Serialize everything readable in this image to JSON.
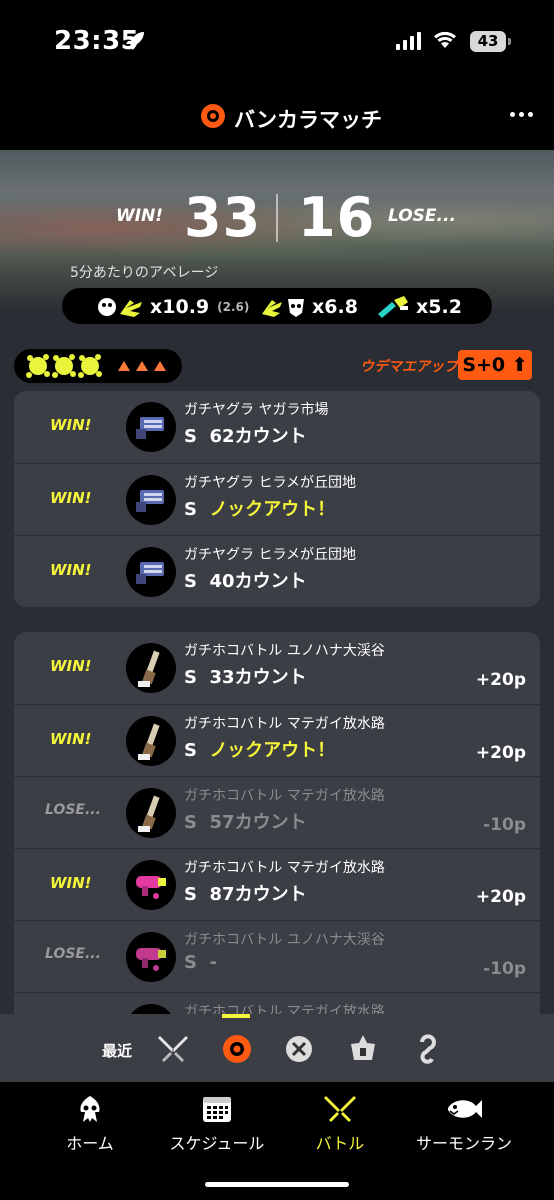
{
  "status_bar": {
    "time": "23:35",
    "battery": "43"
  },
  "header": {
    "title": "バンカラマッチ"
  },
  "summary": {
    "win_label": "WIN!",
    "lose_label": "LOSE...",
    "wins": "33",
    "losses": "16",
    "average_label": "5分あたりのアベレージ",
    "kills": "x10.9",
    "assists": "(2.6)",
    "deaths": "x6.8",
    "specials": "x5.2"
  },
  "rank": {
    "rank_up_text": "ウデマエアップ!",
    "rank_badge": "S+0"
  },
  "group1": [
    {
      "result": "WIN!",
      "mode": "ガチヤグラ ヤガラ市場",
      "rank": "S",
      "detail": "62カウント",
      "knockout": false,
      "points": ""
    },
    {
      "result": "WIN!",
      "mode": "ガチヤグラ ヒラメが丘団地",
      "rank": "S",
      "detail": "ノックアウト！",
      "knockout": true,
      "points": ""
    },
    {
      "result": "WIN!",
      "mode": "ガチヤグラ ヒラメが丘団地",
      "rank": "S",
      "detail": "40カウント",
      "knockout": false,
      "points": ""
    }
  ],
  "group2": [
    {
      "result": "WIN!",
      "mode": "ガチホコバトル ユノハナ大渓谷",
      "rank": "S",
      "detail": "33カウント",
      "knockout": false,
      "points": "+20p"
    },
    {
      "result": "WIN!",
      "mode": "ガチホコバトル マテガイ放水路",
      "rank": "S",
      "detail": "ノックアウト！",
      "knockout": true,
      "points": "+20p"
    },
    {
      "result": "LOSE...",
      "mode": "ガチホコバトル マテガイ放水路",
      "rank": "S",
      "detail": "57カウント",
      "knockout": false,
      "points": "-10p"
    },
    {
      "result": "WIN!",
      "mode": "ガチホコバトル マテガイ放水路",
      "rank": "S",
      "detail": "87カウント",
      "knockout": false,
      "points": "+20p"
    },
    {
      "result": "LOSE...",
      "mode": "ガチホコバトル ユノハナ大渓谷",
      "rank": "S",
      "detail": "-",
      "knockout": false,
      "points": "-10p"
    },
    {
      "result": "",
      "mode": "ガチホコバトル マテガイ放水路",
      "rank": "",
      "detail": "",
      "knockout": false,
      "points": ""
    }
  ],
  "filter": {
    "label": "最近"
  },
  "tabs": {
    "home": "ホーム",
    "schedule": "スケジュール",
    "battle": "バトル",
    "salmon": "サーモンラン"
  },
  "colors": {
    "accent_yellow": "#f5f53a",
    "rank_orange": "#ff5a12",
    "card_bg": "#3b3e45"
  }
}
